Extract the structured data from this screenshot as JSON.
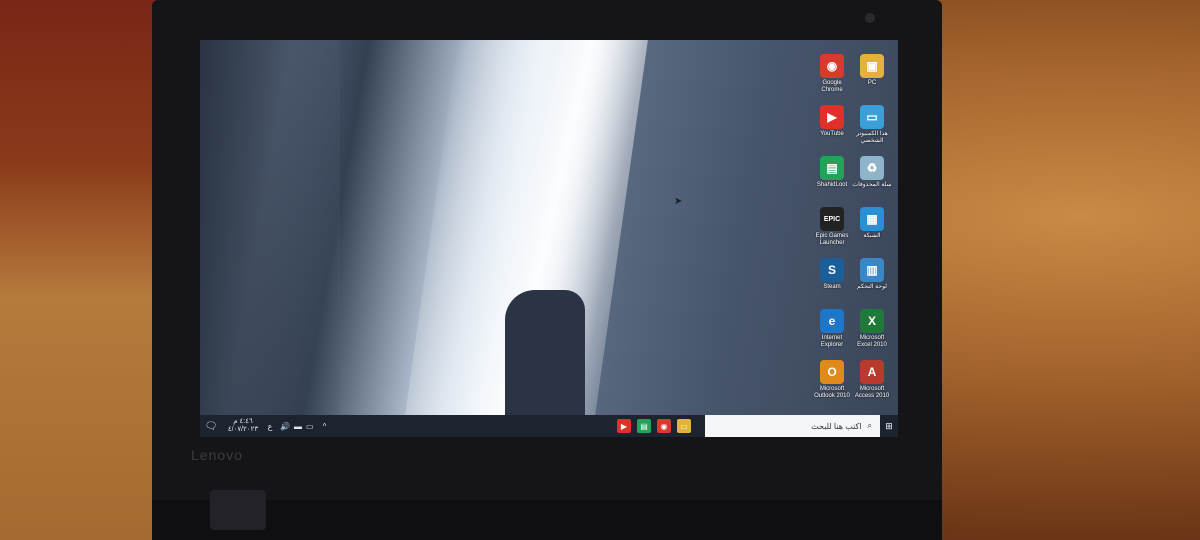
{
  "desktop_icons": [
    {
      "id": "chrome",
      "label": "Google Chrome",
      "color": "#d83b2d",
      "glyph": "◉"
    },
    {
      "id": "pc",
      "label": "PC",
      "color": "#e3b23c",
      "glyph": "▣"
    },
    {
      "id": "youtube",
      "label": "YouTube",
      "color": "#e0302a",
      "glyph": "▶"
    },
    {
      "id": "thispc",
      "label": "هذا الكمبيوتر الشخصي",
      "color": "#3aa0d8",
      "glyph": "▭"
    },
    {
      "id": "shahid",
      "label": "ShahidLoot",
      "color": "#22a35a",
      "glyph": "▤"
    },
    {
      "id": "recycle",
      "label": "سلة المحذوفات",
      "color": "#8fb4c9",
      "glyph": "♻"
    },
    {
      "id": "epic",
      "label": "Epic Games Launcher",
      "color": "#222222",
      "glyph": "EPIC"
    },
    {
      "id": "network",
      "label": "الشبكة",
      "color": "#2b8fd6",
      "glyph": "▦"
    },
    {
      "id": "steam",
      "label": "Steam",
      "color": "#1b5f9a",
      "glyph": "S"
    },
    {
      "id": "control",
      "label": "لوحة التحكم",
      "color": "#3a87c8",
      "glyph": "▥"
    },
    {
      "id": "ie",
      "label": "Internet Explorer",
      "color": "#1e76c8",
      "glyph": "e"
    },
    {
      "id": "excel",
      "label": "Microsoft Excel 2010",
      "color": "#1f7a3a",
      "glyph": "X"
    },
    {
      "id": "outlook",
      "label": "Microsoft Outlook 2010",
      "color": "#e08a1c",
      "glyph": "O"
    },
    {
      "id": "access",
      "label": "Microsoft Access 2010",
      "color": "#b83a2d",
      "glyph": "A"
    }
  ],
  "taskbar": {
    "notification_glyph": "🗨",
    "clock_time": "٤:٤٦ م",
    "clock_date": "٤/٠٧/٢٠٢٣",
    "language": "ع",
    "tray": [
      "🔊",
      "▬",
      "▭"
    ],
    "caret": "^",
    "apps": [
      {
        "id": "youtube",
        "color": "#e0302a",
        "glyph": "▶"
      },
      {
        "id": "shahid",
        "color": "#22a35a",
        "glyph": "▤"
      },
      {
        "id": "chrome",
        "color": "#d83b2d",
        "glyph": "◉"
      },
      {
        "id": "file-explorer",
        "color": "#e3b23c",
        "glyph": "▭"
      }
    ],
    "search_placeholder": "اكتب هنا للبحث",
    "search_glyph": "⌕",
    "start_glyph": "⊞"
  },
  "brand": "Lenovo"
}
